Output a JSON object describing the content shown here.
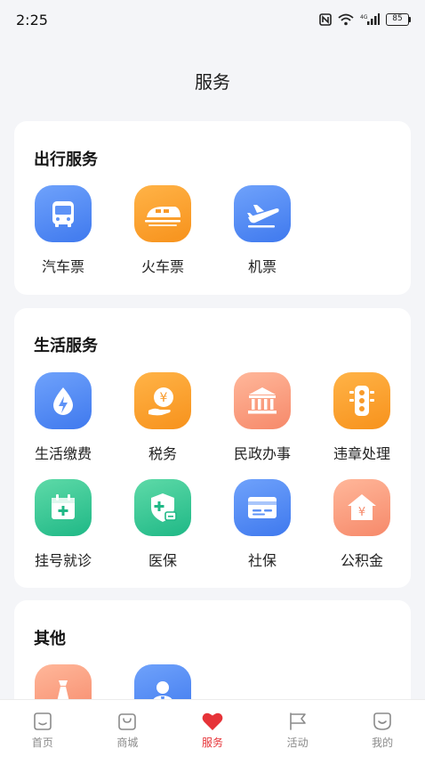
{
  "status": {
    "time": "2:25",
    "battery": "85"
  },
  "page_title": "服务",
  "sections": {
    "travel": {
      "title": "出行服务",
      "items": [
        {
          "label": "汽车票",
          "icon": "bus-icon",
          "color": "#4a85f5"
        },
        {
          "label": "火车票",
          "icon": "train-icon",
          "color": "#f89a2a"
        },
        {
          "label": "机票",
          "icon": "airplane-icon",
          "color": "#4a85f5"
        }
      ]
    },
    "life": {
      "title": "生活服务",
      "items": [
        {
          "label": "生活缴费",
          "icon": "water-bolt-icon",
          "color": "#4a85f5"
        },
        {
          "label": "税务",
          "icon": "yen-hand-icon",
          "color": "#f89a2a"
        },
        {
          "label": "民政办事",
          "icon": "government-building-icon",
          "color": "#f6896a"
        },
        {
          "label": "违章处理",
          "icon": "traffic-light-icon",
          "color": "#f89a2a"
        },
        {
          "label": "挂号就诊",
          "icon": "medical-calendar-icon",
          "color": "#1fb886"
        },
        {
          "label": "医保",
          "icon": "medical-shield-icon",
          "color": "#1fb886"
        },
        {
          "label": "社保",
          "icon": "social-security-card-icon",
          "color": "#4a85f5"
        },
        {
          "label": "公积金",
          "icon": "housing-fund-icon",
          "color": "#f6896a"
        }
      ]
    },
    "other": {
      "title": "其他",
      "items": [
        {
          "icon": "tie-icon",
          "color": "#f6896a"
        },
        {
          "icon": "person-icon",
          "color": "#4a85f5"
        }
      ]
    }
  },
  "tabs": [
    {
      "label": "首页",
      "icon": "home-icon",
      "active": false
    },
    {
      "label": "商城",
      "icon": "shop-bag-icon",
      "active": false
    },
    {
      "label": "服务",
      "icon": "heart-icon",
      "active": true,
      "color": "#e63338"
    },
    {
      "label": "活动",
      "icon": "flag-icon",
      "active": false
    },
    {
      "label": "我的",
      "icon": "smile-icon",
      "active": false
    }
  ]
}
